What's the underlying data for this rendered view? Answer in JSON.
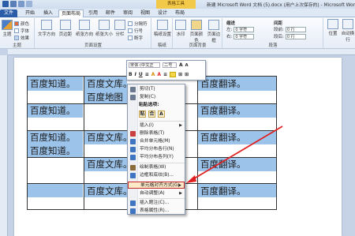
{
  "window": {
    "title": "新建 Microsoft Word 文档 (5).docx (用户上次保存的) - Microsoft Word",
    "context_tab_group": "表格工具"
  },
  "tabs": [
    "文件",
    "开始",
    "插入",
    "页面布局",
    "引用",
    "邮件",
    "审阅",
    "视图",
    "设计",
    "布局"
  ],
  "ribbon": {
    "theme_group": {
      "label": "主题",
      "btn": "主题",
      "colors": "颜色",
      "fonts": "字体",
      "effects": "效果"
    },
    "page_setup": {
      "label": "页面设置",
      "buttons": [
        "文字方向",
        "页边距",
        "纸张方向",
        "纸张大小",
        "分栏"
      ],
      "small": [
        "分隔符",
        "行号",
        "断字"
      ]
    },
    "draft": {
      "btn": "稿纸设置",
      "label": "稿纸"
    },
    "bg": {
      "label": "页面背景",
      "buttons": [
        "水印",
        "页面颜色",
        "页面边框"
      ]
    },
    "paragraph": {
      "label": "段落",
      "indent": "缩进",
      "left": "左:",
      "right": "右:",
      "left_val": "0 字符",
      "right_val": "0 字符",
      "spacing": "间距",
      "before": "段前:",
      "after": "段后:",
      "before_val": "0 行",
      "after_val": "0 行"
    },
    "arrange": {
      "position": "位置",
      "wrap": "自动换行"
    }
  },
  "mini_toolbar": {
    "font": "宋体 (中文正",
    "size": "二号",
    "row2": [
      "B",
      "I",
      "U",
      "≡",
      "A",
      "A",
      "≡",
      "⊞",
      "⊞"
    ]
  },
  "table": {
    "cells": [
      "百度知道。",
      "百度文库。",
      "百度翻译。",
      "百度地图",
      "百度知道。",
      "百度翻译。",
      "百度知道。",
      "百度文库。",
      "百度翻译。",
      "百度知道。",
      "百度文库。",
      "百度翻译。",
      "百度文库。",
      "百度翻译。"
    ]
  },
  "context_menu": {
    "items": [
      {
        "label": "剪切(T)",
        "icon": "scissors-icon",
        "color": "#6b7a8f"
      },
      {
        "label": "复制(C)",
        "icon": "copy-icon",
        "color": "#6b7a8f"
      },
      {
        "label": "粘贴选项:",
        "header": true
      },
      {
        "label": "插入(I)",
        "submenu": true
      },
      {
        "label": "删除表格(T)",
        "icon": "delete-table-icon",
        "color": "#c94040"
      },
      {
        "label": "合并单元格(M)",
        "icon": "merge-cells-icon",
        "color": "#3f75c1"
      },
      {
        "label": "平均分布各行(N)",
        "icon": "distribute-rows-icon",
        "color": "#3f75c1"
      },
      {
        "label": "平均分布各列(Y)",
        "icon": "distribute-cols-icon",
        "color": "#3f75c1"
      },
      {
        "label": "绘制表格(W)",
        "icon": "draw-table-icon",
        "color": "#8a6b3c"
      },
      {
        "label": "边框和底纹(B)...",
        "icon": "borders-icon",
        "color": "#3f75c1"
      },
      {
        "label": "单元格对齐方式(G)",
        "submenu": true,
        "highlight": true
      },
      {
        "label": "自动调整(A)",
        "submenu": true
      },
      {
        "label": "插入题注(C)...",
        "icon": "caption-icon",
        "color": "#3f75c1"
      },
      {
        "label": "表格属性(R)...",
        "icon": "table-properties-icon",
        "color": "#3f75c1"
      }
    ],
    "paste_icons": [
      "粘",
      "合",
      "A"
    ]
  },
  "colors": {
    "selection": "#9cc3ea",
    "annotation_arrow": "#e02020",
    "highlight_border": "#c52828"
  }
}
